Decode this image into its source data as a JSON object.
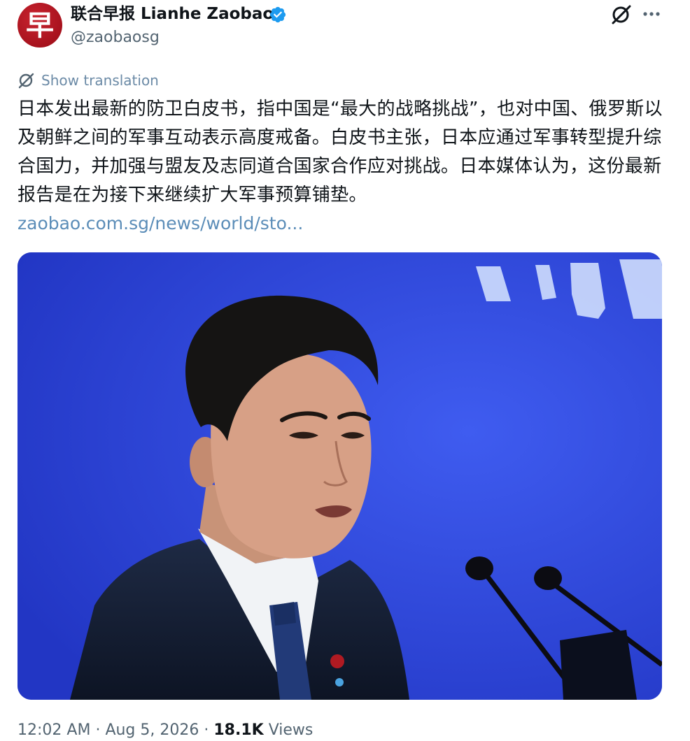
{
  "account": {
    "avatar_glyph": "早",
    "display_name": "联合早报 Lianhe Zaobao",
    "handle": "@zaobaosg",
    "verified": true,
    "verified_color": "#1d9bf0",
    "avatar_color": "#b01622"
  },
  "header_actions": {
    "grok_icon": "grok-icon",
    "more_icon": "more-dots-icon"
  },
  "translation": {
    "label": "Show translation"
  },
  "post": {
    "text": "日本发出最新的防卫白皮书，指中国是“最大的战略挑战”，也对中国、俄罗斯以及朝鲜之间的军事互动表示高度戒备。白皮书主张，日本应通过军事转型提升综合国力，并加强与盟友及志同道合国家合作应对挑战。日本媒体认为，这份最新报告是在为接下来继续扩大军事预算铺垫。",
    "link_text": "zaobao.com.sg/news/world/sto..."
  },
  "media": {
    "type": "photo",
    "background_color": "#2b45d8"
  },
  "meta": {
    "time": "12:02 AM",
    "date": "Aug 5, 2026",
    "views_count": "18.1K",
    "views_label": "Views",
    "separator": "·"
  }
}
